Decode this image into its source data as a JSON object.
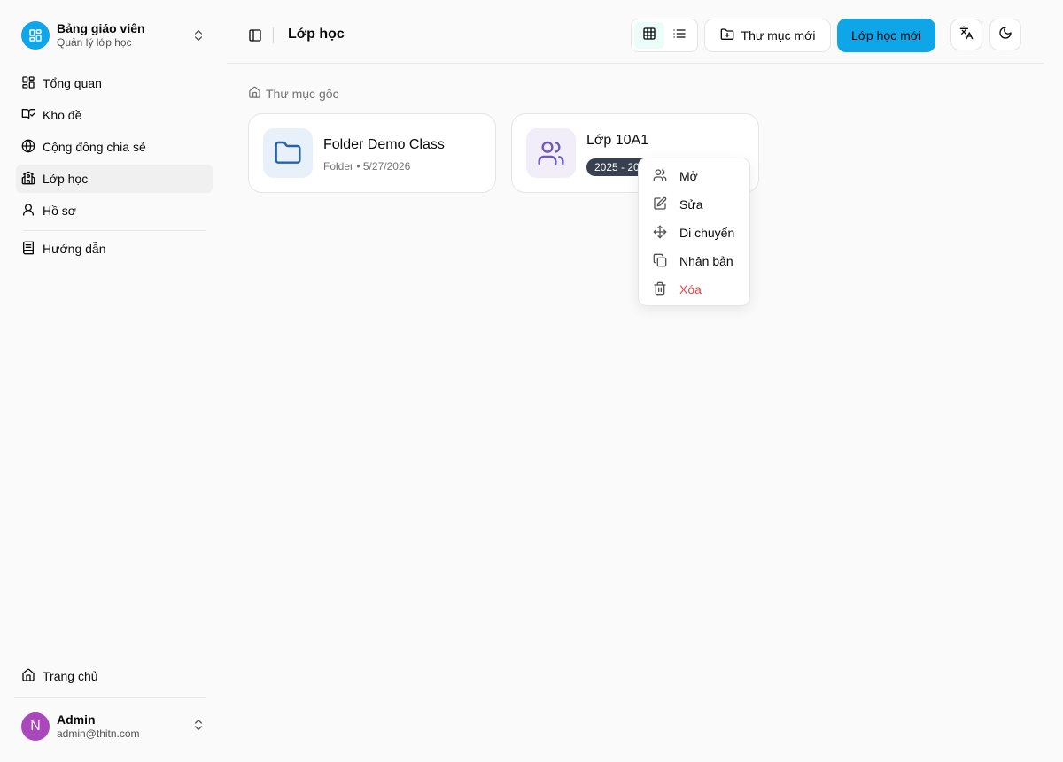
{
  "brand": {
    "title": "Bảng giáo viên",
    "subtitle": "Quản lý lớp học"
  },
  "sidebar": {
    "items": [
      {
        "label": "Tổng quan",
        "icon": "layout-dashboard-icon"
      },
      {
        "label": "Kho đề",
        "icon": "book-open-icon"
      },
      {
        "label": "Cộng đồng chia sẻ",
        "icon": "globe-icon"
      },
      {
        "label": "Lớp học",
        "icon": "school-icon",
        "active": true
      },
      {
        "label": "Hồ sơ",
        "icon": "user-icon"
      },
      {
        "label": "Hướng dẫn",
        "icon": "book-icon"
      }
    ],
    "home": "Trang chủ"
  },
  "user": {
    "initial": "N",
    "name": "Admin",
    "email": "admin@thitn.com"
  },
  "header": {
    "title": "Lớp học",
    "new_folder": "Thư mục mới",
    "new_class": "Lớp học mới"
  },
  "breadcrumb": {
    "root": "Thư mục gốc"
  },
  "cards": [
    {
      "title": "Folder Demo Class",
      "meta": "Folder • 5/27/2026"
    },
    {
      "title": "Lớp 10A1",
      "badge": "2025 - 2026"
    }
  ],
  "context_menu": {
    "items": [
      {
        "label": "Mở"
      },
      {
        "label": "Sửa"
      },
      {
        "label": "Di chuyển"
      },
      {
        "label": "Nhân bản"
      },
      {
        "label": "Xóa",
        "danger": true
      }
    ]
  },
  "colors": {
    "accent": "#0ea5e9",
    "badge": "#374151",
    "danger": "#ef4444",
    "avatar": "#ab47bc"
  }
}
